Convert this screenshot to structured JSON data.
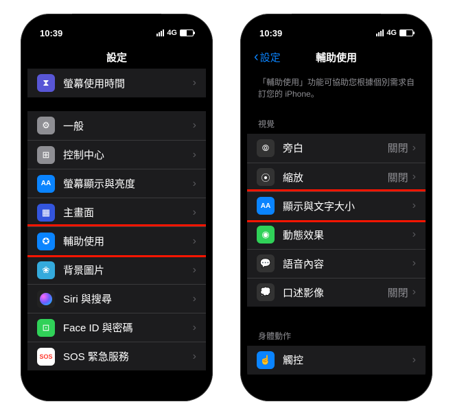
{
  "left": {
    "time": "10:39",
    "network": "4G",
    "title": "設定",
    "groups": [
      {
        "rows": [
          {
            "icon": "hourglass-icon",
            "iconClass": "ic-hourglass",
            "glyph": "⧗",
            "label": "螢幕使用時間"
          }
        ]
      },
      {
        "rows": [
          {
            "icon": "gear-icon",
            "iconClass": "ic-gear",
            "glyph": "⚙",
            "label": "一般"
          },
          {
            "icon": "control-center-icon",
            "iconClass": "ic-control",
            "glyph": "⊞",
            "label": "控制中心"
          },
          {
            "icon": "display-icon",
            "iconClass": "ic-display",
            "glyph": "AA",
            "label": "螢幕顯示與亮度"
          },
          {
            "icon": "home-screen-icon",
            "iconClass": "ic-home",
            "glyph": "▦",
            "label": "主畫面"
          },
          {
            "icon": "accessibility-icon",
            "iconClass": "ic-access",
            "glyph": "✪",
            "label": "輔助使用",
            "highlight": true
          },
          {
            "icon": "wallpaper-icon",
            "iconClass": "ic-wallpaper",
            "glyph": "❀",
            "label": "背景圖片"
          },
          {
            "icon": "siri-icon",
            "iconClass": "ic-siri",
            "glyph": "siri",
            "label": "Siri 與搜尋"
          },
          {
            "icon": "faceid-icon",
            "iconClass": "ic-faceid",
            "glyph": "⊡",
            "label": "Face ID 與密碼"
          },
          {
            "icon": "sos-icon",
            "iconClass": "ic-sos",
            "glyph": "SOS",
            "label": "SOS 緊急服務"
          }
        ]
      }
    ]
  },
  "right": {
    "time": "10:39",
    "network": "4G",
    "back": "設定",
    "title": "輔助使用",
    "description": "「輔助使用」功能可協助您根據個別需求自訂您的 iPhone。",
    "sections": [
      {
        "header": "視覺",
        "rows": [
          {
            "icon": "voiceover-icon",
            "iconClass": "ic-voiceover",
            "glyph": "⦾",
            "label": "旁白",
            "value": "關閉"
          },
          {
            "icon": "zoom-icon",
            "iconClass": "ic-zoom",
            "glyph": "⦿",
            "label": "縮放",
            "value": "關閉"
          },
          {
            "icon": "text-size-icon",
            "iconClass": "ic-textsize",
            "glyph": "AA",
            "label": "顯示與文字大小",
            "highlight": true
          },
          {
            "icon": "motion-icon",
            "iconClass": "ic-motion",
            "glyph": "◉",
            "label": "動態效果"
          },
          {
            "icon": "spoken-content-icon",
            "iconClass": "ic-speech",
            "glyph": "💬",
            "label": "語音內容"
          },
          {
            "icon": "audio-description-icon",
            "iconClass": "ic-audiodesc",
            "glyph": "💭",
            "label": "口述影像",
            "value": "關閉"
          }
        ]
      },
      {
        "header": "身體動作",
        "rows": [
          {
            "icon": "touch-icon",
            "iconClass": "ic-touch",
            "glyph": "☝",
            "label": "觸控"
          }
        ]
      }
    ]
  }
}
